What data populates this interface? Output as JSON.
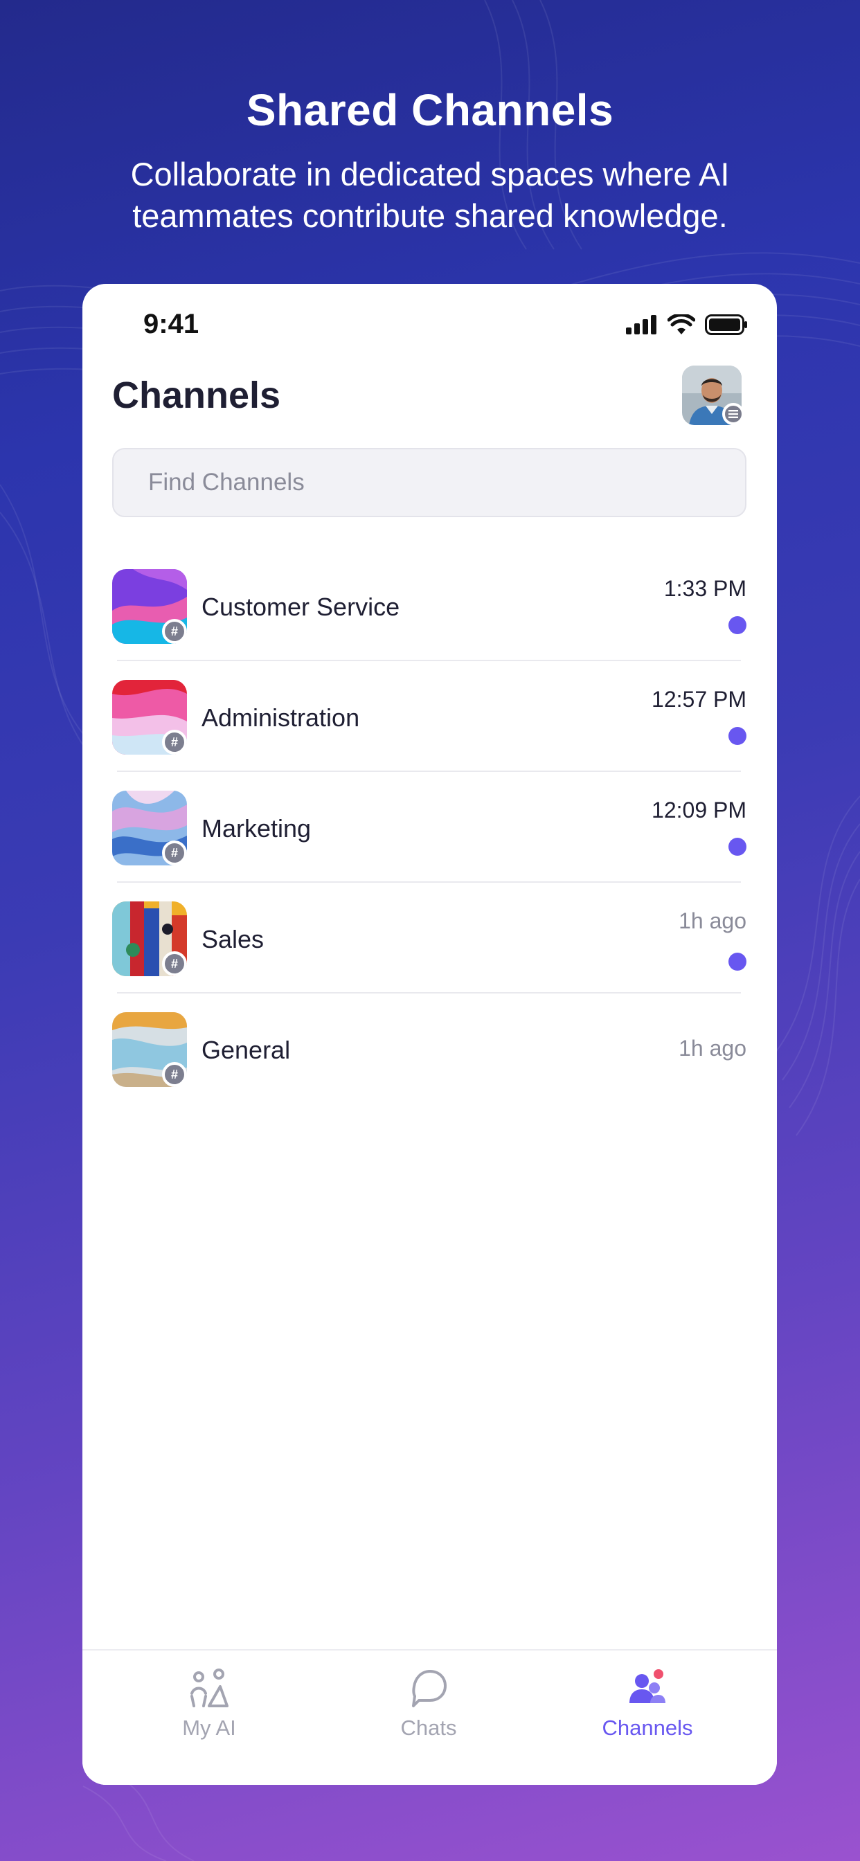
{
  "hero": {
    "title": "Shared Channels",
    "subtitle": "Collaborate in dedicated spaces where AI teammates contribute shared knowledge."
  },
  "status_bar": {
    "time": "9:41"
  },
  "screen": {
    "title": "Channels",
    "search_placeholder": "Find Channels"
  },
  "channels": [
    {
      "name": "Customer Service",
      "time": "1:33 PM",
      "unread": true,
      "thumb_colors": [
        "#7b3fe0",
        "#e85db0",
        "#16b7e6"
      ]
    },
    {
      "name": "Administration",
      "time": "12:57 PM",
      "unread": true,
      "thumb_colors": [
        "#e2243a",
        "#f08fd0",
        "#cfe6f6"
      ]
    },
    {
      "name": "Marketing",
      "time": "12:09 PM",
      "unread": true,
      "thumb_colors": [
        "#8db8e8",
        "#d8a4e0",
        "#3a6fc8"
      ]
    },
    {
      "name": "Sales",
      "time": "1h ago",
      "unread": true,
      "thumb_colors": [
        "#c8262e",
        "#7fc8d8",
        "#f0b02a"
      ]
    },
    {
      "name": "General",
      "time": "1h ago",
      "unread": false,
      "thumb_colors": [
        "#e8a640",
        "#8fc7e0",
        "#d6dfe4"
      ]
    }
  ],
  "tabs": [
    {
      "label": "My AI",
      "icon": "my-ai-icon",
      "active": false
    },
    {
      "label": "Chats",
      "icon": "chat-bubble-icon",
      "active": false
    },
    {
      "label": "Channels",
      "icon": "channels-people-icon",
      "active": true
    }
  ],
  "colors": {
    "accent": "#6857f0",
    "badge": "#f0506e",
    "muted": "#8a8b99",
    "text": "#1f1f33"
  }
}
